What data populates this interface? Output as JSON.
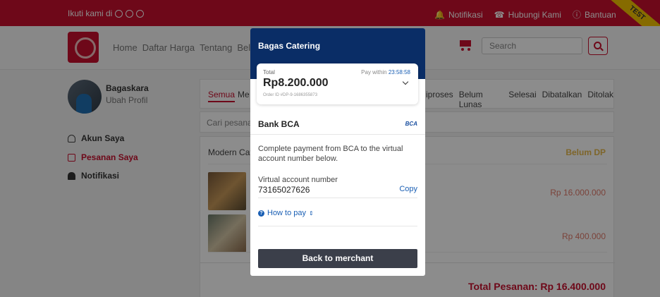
{
  "topbar": {
    "follow_label": "Ikuti kami di",
    "notifications": "Notifikasi",
    "contact": "Hubungi Kami",
    "help": "Bantuan",
    "ribbon": "TEST"
  },
  "nav": {
    "links": [
      "Home",
      "Daftar Harga",
      "Tentang",
      "Belanja"
    ],
    "search_placeholder": "Search"
  },
  "profile": {
    "name": "Bagaskara",
    "edit": "Ubah Profil"
  },
  "sidebar": {
    "items": [
      {
        "label": "Akun Saya",
        "icon": "user-icon"
      },
      {
        "label": "Pesanan Saya",
        "icon": "order-icon"
      },
      {
        "label": "Notifikasi",
        "icon": "bell-icon"
      }
    ]
  },
  "tabs": {
    "first": "Semua",
    "second": "Me",
    "right": [
      "iproses",
      "Belum Lunas",
      "Selesai",
      "Dibatalkan",
      "Ditolak"
    ]
  },
  "orders": {
    "search_placeholder": "Cari pesanan",
    "shop": "Modern Cate",
    "status": "Belum DP",
    "prices": [
      "Rp 16.000.000",
      "Rp 400.000"
    ],
    "total": "Total Pesanan: Rp 16.400.000"
  },
  "modal": {
    "title": "Bagas Catering",
    "total_label": "Total",
    "pay_within_label": "Pay within",
    "timer": "23:58:58",
    "amount": "Rp8.200.000",
    "order_id": "Order ID #DP-9-1686355873",
    "bank": "Bank BCA",
    "bank_logo": "BCA",
    "description": "Complete payment from BCA to the virtual account number below.",
    "va_label": "Virtual account number",
    "va_number": "73165027626",
    "copy_label": "Copy",
    "how_to_pay": "How to pay",
    "back_button": "Back to merchant"
  },
  "colors": {
    "brand_red": "#c8102e",
    "modal_header": "#0a2d66",
    "link_blue": "#1a5fb4",
    "status_yellow": "#e6b84c"
  }
}
